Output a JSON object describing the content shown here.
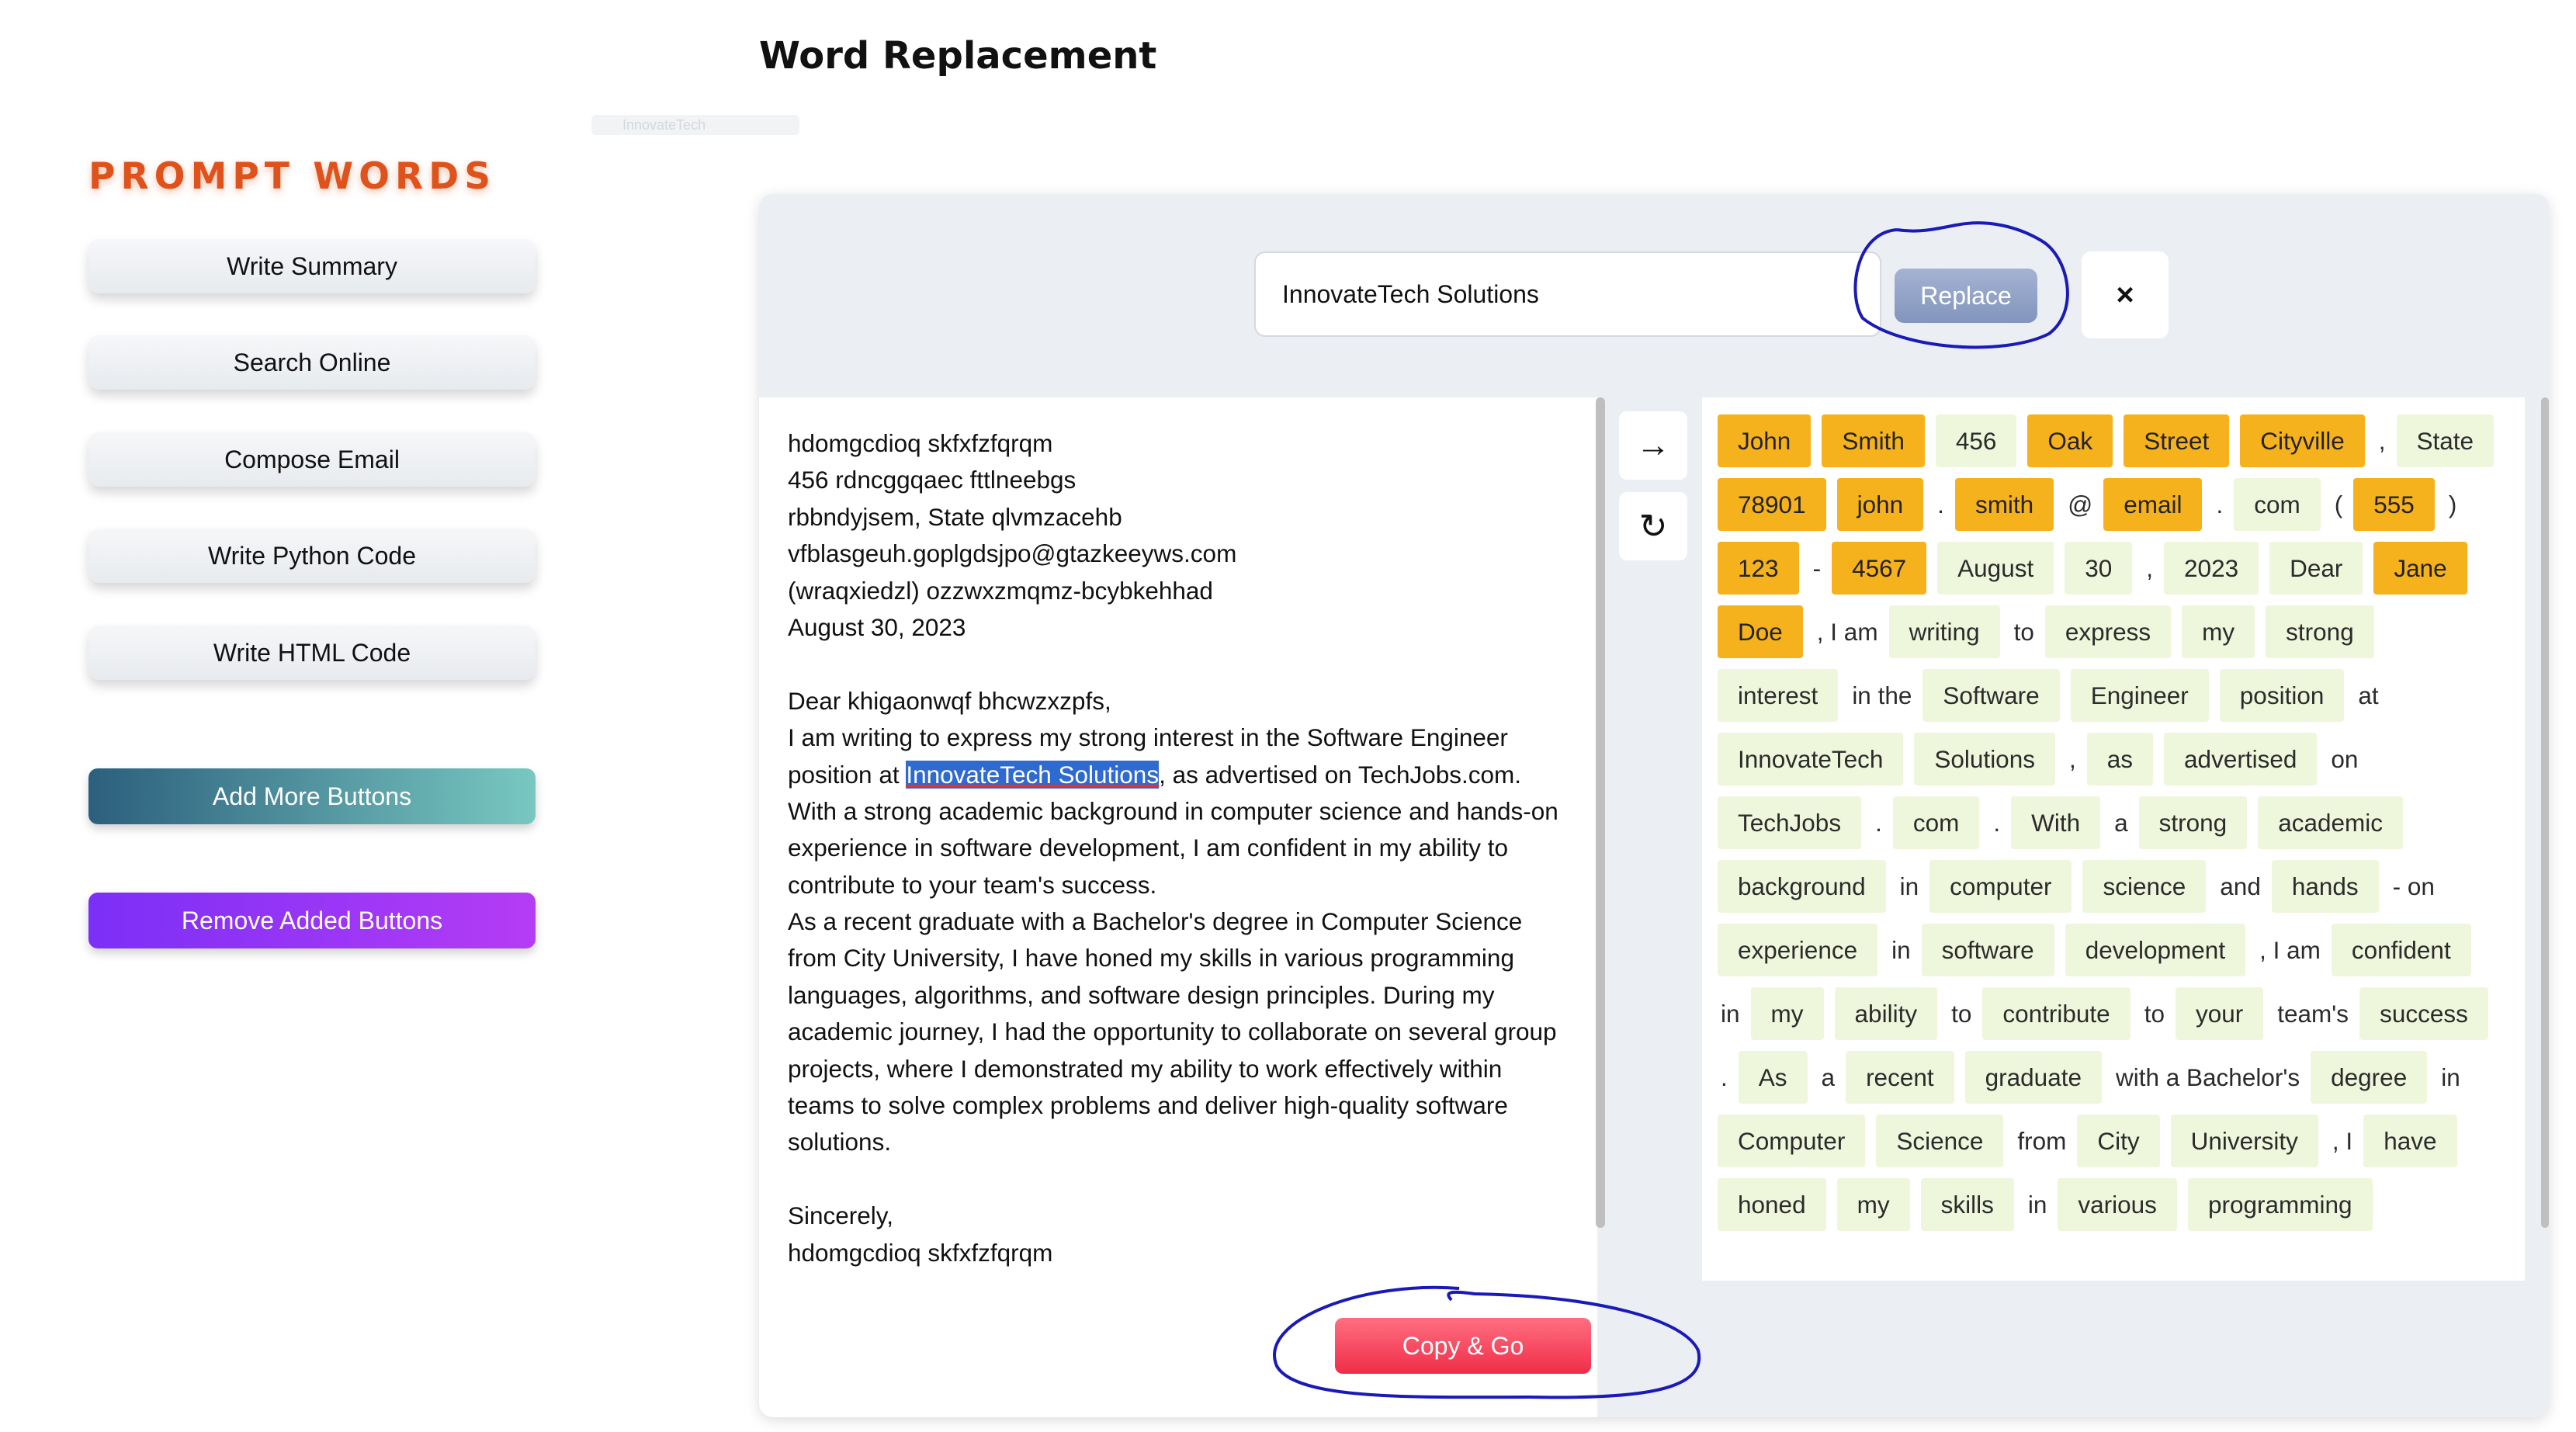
{
  "page": {
    "title": "Word Replacement",
    "faint_tag": "InnovateTech"
  },
  "sidebar": {
    "title": "PROMPT WORDS",
    "buttons": [
      "Write Summary",
      "Search Online",
      "Compose Email",
      "Write Python Code",
      "Write HTML Code"
    ],
    "add_label": "Add More Buttons",
    "remove_label": "Remove Added Buttons"
  },
  "search": {
    "value": "InnovateTech Solutions",
    "replace_label": "Replace",
    "close_label": "×"
  },
  "tools": {
    "arrow_label": "→",
    "refresh_label": "↻"
  },
  "letter": {
    "lines": [
      "hdomgcdioq skfxfzfqrqm",
      "456 rdncggqaec fttlneebgs",
      "rbbndyjsem, State qlvmzacehb",
      "vfblasgeuh.goplgdsjpo@gtazkeeyws.com",
      "(wraqxiedzl) ozzwxzmqmz-bcybkehhad",
      "August 30, 2023",
      "",
      "Dear khigaonwqf bhcwzxzpfs,",
      "I am writing to express my strong interest in the Software Engineer"
    ],
    "sel_before": "position at ",
    "selected": "InnovateTech Solutions",
    "sel_after": ", as advertised on TechJobs.com.",
    "lines_after": [
      "With a strong academic background in computer science and hands-on",
      "experience in software development, I am confident in my ability to",
      "contribute to your team's success.",
      "As a recent graduate with a Bachelor's degree in Computer Science",
      "from City University, I have honed my skills in various programming",
      "languages, algorithms, and software design principles. During my",
      "academic journey, I had the opportunity to collaborate on several group",
      "projects, where I demonstrated my ability to work effectively within",
      "teams to solve complex problems and deliver high-quality software",
      "solutions.",
      "",
      "Sincerely,",
      "hdomgcdioq skfxfzfqrqm"
    ]
  },
  "tokens": [
    {
      "t": "John",
      "k": "h"
    },
    {
      "t": "Smith",
      "k": "h"
    },
    {
      "t": "456",
      "k": "w"
    },
    {
      "t": "Oak",
      "k": "h"
    },
    {
      "t": "Street",
      "k": "h"
    },
    {
      "t": "Cityville",
      "k": "h"
    },
    {
      "t": ",",
      "k": "p"
    },
    {
      "t": "State",
      "k": "w"
    },
    {
      "t": "78901",
      "k": "h"
    },
    {
      "t": "john",
      "k": "h"
    },
    {
      "t": ".",
      "k": "p"
    },
    {
      "t": "smith",
      "k": "h"
    },
    {
      "t": "@",
      "k": "p"
    },
    {
      "t": "email",
      "k": "h"
    },
    {
      "t": ".",
      "k": "p"
    },
    {
      "t": "com",
      "k": "w"
    },
    {
      "t": "(",
      "k": "p"
    },
    {
      "t": "555",
      "k": "h"
    },
    {
      "t": ")",
      "k": "p"
    },
    {
      "t": "123",
      "k": "h"
    },
    {
      "t": "-",
      "k": "p"
    },
    {
      "t": "4567",
      "k": "h"
    },
    {
      "t": "August",
      "k": "w"
    },
    {
      "t": "30",
      "k": "w"
    },
    {
      "t": ",",
      "k": "p"
    },
    {
      "t": "2023",
      "k": "w"
    },
    {
      "t": "Dear",
      "k": "w"
    },
    {
      "t": "Jane",
      "k": "h"
    },
    {
      "t": "Doe",
      "k": "h"
    },
    {
      "t": ", I am",
      "k": "p"
    },
    {
      "t": "writing",
      "k": "w"
    },
    {
      "t": "to",
      "k": "p"
    },
    {
      "t": "express",
      "k": "w"
    },
    {
      "t": "my",
      "k": "w"
    },
    {
      "t": "strong",
      "k": "w"
    },
    {
      "t": "interest",
      "k": "w"
    },
    {
      "t": "in the",
      "k": "p"
    },
    {
      "t": "Software",
      "k": "w"
    },
    {
      "t": "Engineer",
      "k": "w"
    },
    {
      "t": "position",
      "k": "w"
    },
    {
      "t": "at",
      "k": "p"
    },
    {
      "t": "InnovateTech",
      "k": "w"
    },
    {
      "t": "Solutions",
      "k": "w"
    },
    {
      "t": ",",
      "k": "p"
    },
    {
      "t": "as",
      "k": "w"
    },
    {
      "t": "advertised",
      "k": "w"
    },
    {
      "t": "on",
      "k": "p"
    },
    {
      "t": "TechJobs",
      "k": "w"
    },
    {
      "t": ".",
      "k": "p"
    },
    {
      "t": "com",
      "k": "w"
    },
    {
      "t": ".",
      "k": "p"
    },
    {
      "t": "With",
      "k": "w"
    },
    {
      "t": "a",
      "k": "p"
    },
    {
      "t": "strong",
      "k": "w"
    },
    {
      "t": "academic",
      "k": "w"
    },
    {
      "t": "background",
      "k": "w"
    },
    {
      "t": "in",
      "k": "p"
    },
    {
      "t": "computer",
      "k": "w"
    },
    {
      "t": "science",
      "k": "w"
    },
    {
      "t": "and",
      "k": "p"
    },
    {
      "t": "hands",
      "k": "w"
    },
    {
      "t": "- on",
      "k": "p"
    },
    {
      "t": "experience",
      "k": "w"
    },
    {
      "t": "in",
      "k": "p"
    },
    {
      "t": "software",
      "k": "w"
    },
    {
      "t": "development",
      "k": "w"
    },
    {
      "t": ", I am",
      "k": "p"
    },
    {
      "t": "confident",
      "k": "w"
    },
    {
      "t": "in",
      "k": "p"
    },
    {
      "t": "my",
      "k": "w"
    },
    {
      "t": "ability",
      "k": "w"
    },
    {
      "t": "to",
      "k": "p"
    },
    {
      "t": "contribute",
      "k": "w"
    },
    {
      "t": "to",
      "k": "p"
    },
    {
      "t": "your",
      "k": "w"
    },
    {
      "t": "team's",
      "k": "p"
    },
    {
      "t": "success",
      "k": "w"
    },
    {
      "t": ".",
      "k": "p"
    },
    {
      "t": "As",
      "k": "w"
    },
    {
      "t": "a",
      "k": "p"
    },
    {
      "t": "recent",
      "k": "w"
    },
    {
      "t": "graduate",
      "k": "w"
    },
    {
      "t": "with a Bachelor's",
      "k": "p"
    },
    {
      "t": "degree",
      "k": "w"
    },
    {
      "t": "in",
      "k": "p"
    },
    {
      "t": "Computer",
      "k": "w"
    },
    {
      "t": "Science",
      "k": "w"
    },
    {
      "t": "from",
      "k": "p"
    },
    {
      "t": "City",
      "k": "w"
    },
    {
      "t": "University",
      "k": "w"
    },
    {
      "t": ", I",
      "k": "p"
    },
    {
      "t": "have",
      "k": "w"
    },
    {
      "t": "honed",
      "k": "w"
    },
    {
      "t": "my",
      "k": "w"
    },
    {
      "t": "skills",
      "k": "w"
    },
    {
      "t": "in",
      "k": "p"
    },
    {
      "t": "various",
      "k": "w"
    },
    {
      "t": "programming",
      "k": "w"
    }
  ],
  "footer": {
    "copy_label": "Copy & Go"
  },
  "colors": {
    "highlight": "#f6b21c",
    "token_bg": "#eef7dc",
    "selection": "#2f6ad0",
    "annotation": "#1a1ab8"
  }
}
